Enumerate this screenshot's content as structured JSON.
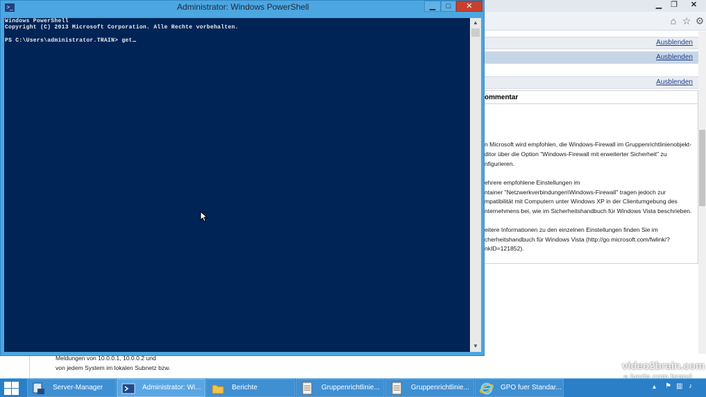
{
  "ie": {
    "hide_links": [
      "Ausblenden",
      "Ausblenden",
      "Ausblenden"
    ],
    "comment_header": "ommentar",
    "comment_lines": [
      "n Microsoft wird empfohlen, die Windows-Firewall im Gruppenrichtlinienobjekt-",
      "ditor über die Option \"Windows-Firewall mit erweiterter Sicherheit\" zu",
      "nfigurieren.",
      "",
      "ehrere empfohlene Einstellungen im",
      "ntainer \"Netzwerkverbindungen\\Windows-Firewall\" tragen jedoch zur",
      "mpatibilität mit Computern unter Windows XP in der Clientumgebung des",
      "nternehmens bei, wie im Sicherheitshandbuch für Windows Vista beschrieben.",
      "",
      "eitere Informationen zu den einzelnen Einstellungen finden Sie im",
      "cherheitshandbuch für Windows Vista (http://go.microsoft.com/fwlink/?",
      "nkID=121852)."
    ],
    "bottom_lines": [
      "Meldungen von 10.0.0.1, 10.0.0.2 und",
      "von jedem System im lokalen Subnetz bzw."
    ]
  },
  "powershell": {
    "title": "Administrator: Windows PowerShell",
    "lines": [
      "Windows PowerShell",
      "Copyright (C) 2013 Microsoft Corporation. Alle Rechte vorbehalten.",
      "",
      "PS C:\\Users\\administrator.TRAIN> get"
    ]
  },
  "watermark": {
    "line1": "video2brain.com",
    "line2": "a lynda.com brand"
  },
  "taskbar": {
    "items": [
      {
        "label": "Server-Manager",
        "icon": "server-manager-icon"
      },
      {
        "label": "Administrator: Wi...",
        "icon": "powershell-icon"
      },
      {
        "label": "Berichte",
        "icon": "folder-icon"
      },
      {
        "label": "Gruppenrichtlinie...",
        "icon": "gpo-document-icon"
      },
      {
        "label": "Gruppenrichtlinie...",
        "icon": "gpo-document-icon"
      },
      {
        "label": "GPO fuer Standar...",
        "icon": "internet-explorer-icon"
      }
    ]
  }
}
